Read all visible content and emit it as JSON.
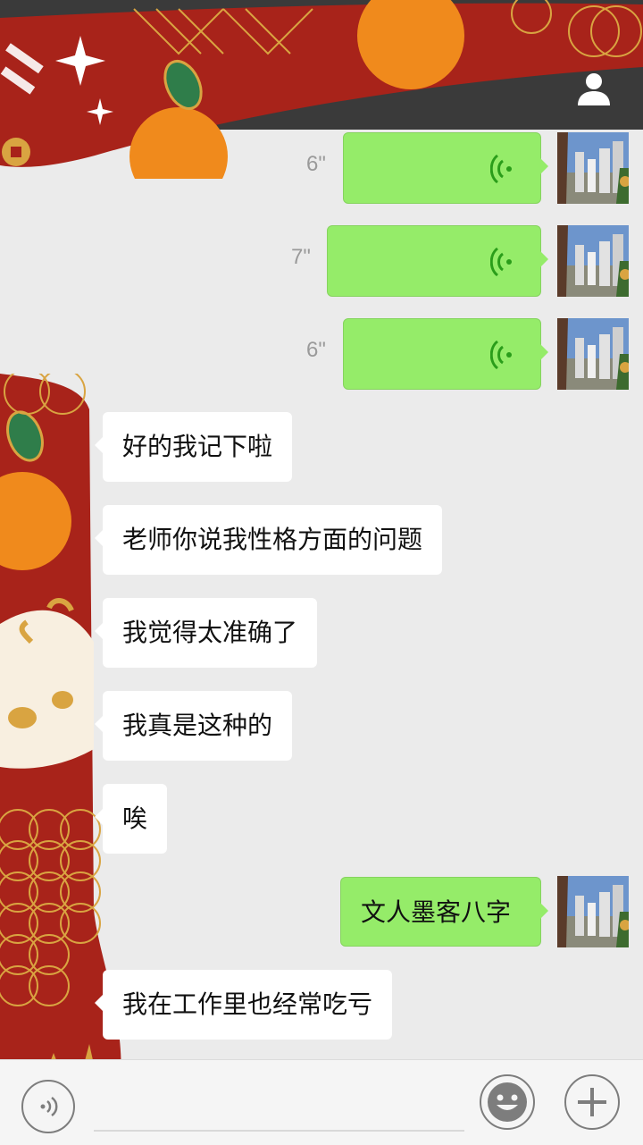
{
  "colors": {
    "header_bg": "#3a3a3a",
    "chat_bg": "#ebebeb",
    "sent_bubble": "#95ec69",
    "received_bubble": "#ffffff",
    "deco_red": "#a8231a",
    "deco_gold": "#d9a441",
    "deco_orange": "#f08a1c"
  },
  "header": {
    "profile_icon": "person-icon"
  },
  "messages": [
    {
      "side": "right",
      "kind": "voice",
      "duration": "6\""
    },
    {
      "side": "right",
      "kind": "voice",
      "duration": "7\""
    },
    {
      "side": "right",
      "kind": "voice",
      "duration": "6\""
    },
    {
      "side": "left",
      "kind": "text",
      "text": "好的我记下啦"
    },
    {
      "side": "left",
      "kind": "text",
      "text": "老师你说我性格方面的问题"
    },
    {
      "side": "left",
      "kind": "text",
      "text": "我觉得太准确了"
    },
    {
      "side": "left",
      "kind": "text",
      "text": "我真是这种的"
    },
    {
      "side": "left",
      "kind": "text",
      "text": "唉"
    },
    {
      "side": "right",
      "kind": "text",
      "text": "文人墨客八字"
    },
    {
      "side": "left",
      "kind": "text",
      "text": "我在工作里也经常吃亏"
    }
  ],
  "bottom_bar": {
    "voice_icon": "voice-wave-icon",
    "emoji_icon": "smiley-icon",
    "more_icon": "plus-icon"
  }
}
